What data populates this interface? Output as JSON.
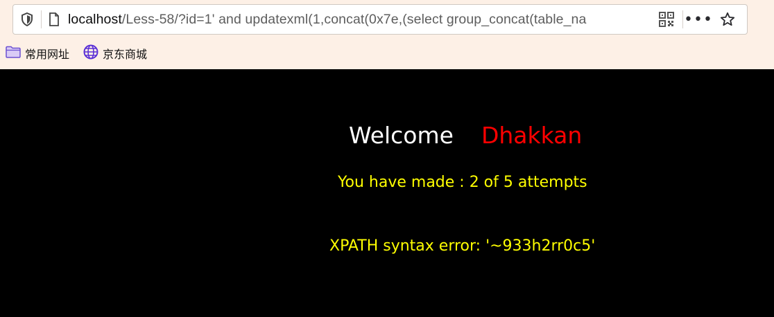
{
  "browser": {
    "url_host": "localhost",
    "url_rest": "/Less-58/?id=1' and updatexml(1,concat(0x7e,(select group_concat(table_na",
    "icons": {
      "tracking": "shield-icon",
      "page": "page-icon",
      "qr": "qr-code-icon",
      "menu": "more-icon",
      "bookmark": "star-icon"
    },
    "menu_glyph": "•••",
    "bookmarks": [
      {
        "label": "常用网址",
        "icon": "folder-icon"
      },
      {
        "label": "京东商城",
        "icon": "globe-icon"
      }
    ]
  },
  "page": {
    "welcome_word": "Welcome",
    "welcome_name": "Dhakkan",
    "attempts_text": "You have made : 2 of 5 attempts",
    "error_text": "XPATH syntax error: '~933h2rr0c5'"
  },
  "colors": {
    "background": "#000000",
    "welcome": "#ffffff",
    "name": "#ff0000",
    "message": "#ffff00"
  }
}
